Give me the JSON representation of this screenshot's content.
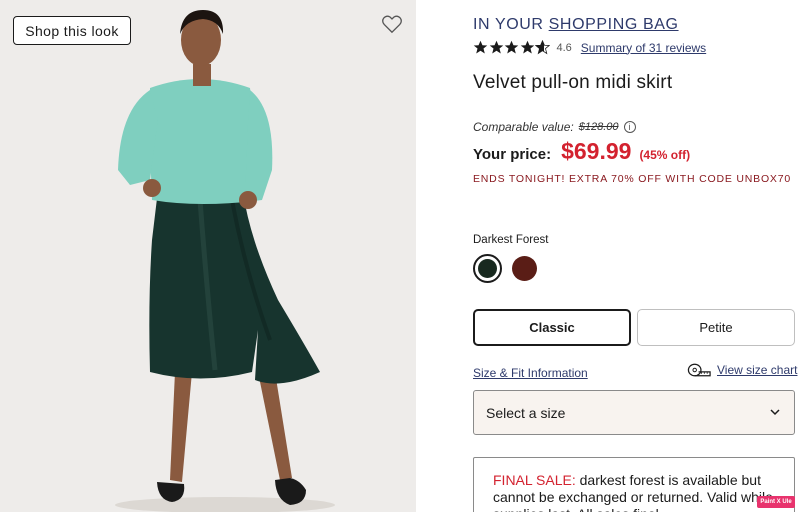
{
  "image_panel": {
    "shop_button_label": "Shop this look",
    "heart_icon": "heart-outline-icon"
  },
  "product": {
    "bag_prefix": "IN YOUR",
    "bag_link": "SHOPPING BAG",
    "rating_value": "4.6",
    "rating_stars": 4.6,
    "reviews_link": "Summary of 31 reviews",
    "title": "Velvet pull-on midi skirt",
    "comparable_label": "Comparable value:",
    "comparable_value": "$128.00",
    "price_label": "Your price:",
    "price": "$69.99",
    "discount": "(45% off)",
    "promo": "ENDS TONIGHT! EXTRA 70% OFF WITH CODE UNBOX70"
  },
  "color": {
    "label": "Darkest Forest",
    "swatches": [
      {
        "name": "Darkest Forest",
        "hex": "#18291f",
        "selected": true
      },
      {
        "name": "burgundy",
        "hex": "#5a1d16",
        "selected": false
      }
    ]
  },
  "fit": {
    "options": [
      "Classic",
      "Petite"
    ],
    "selected": "Classic"
  },
  "size": {
    "size_fit_link": "Size & Fit Information",
    "size_chart_link": "View size chart",
    "select_placeholder": "Select a size"
  },
  "notice": {
    "label": "FINAL SALE:",
    "text": "darkest forest is available but cannot be exchanged or returned. Valid while supplies last. All sales final."
  },
  "badge": {
    "label": "Paint X Ule"
  },
  "colors": {
    "accent_price": "#d3222f",
    "link": "#2e3a6b",
    "promo": "#8a1a20",
    "select_bg": "#f8f3ef"
  }
}
